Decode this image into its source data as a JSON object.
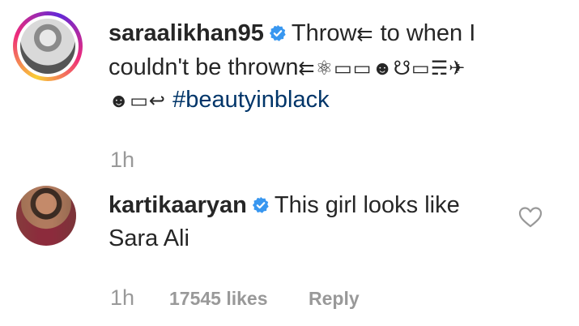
{
  "comments": [
    {
      "username": "saraalikhan95",
      "verified": true,
      "text_line1_a": "Throw",
      "text_line1_emoji": "⇇",
      "text_line1_b": "to when I",
      "text_line2_a": "couldn't be thrown",
      "text_line2_emoji": "⇇⚛▭▭☻☋▭☴✈",
      "text_line3_emoji": "☻▭↩",
      "hashtag": "#beautyinblack",
      "time": "1h"
    },
    {
      "username": "kartikaaryan",
      "verified": true,
      "text_line1": "This girl looks like",
      "text_line2": "Sara Ali",
      "time": "1h",
      "likes": "17545 likes",
      "reply": "Reply"
    }
  ],
  "colors": {
    "text": "#262626",
    "meta": "#999999",
    "hashtag": "#003569",
    "verified": "#3897f0"
  },
  "icons": [
    "verified-badge-icon",
    "heart-icon"
  ]
}
